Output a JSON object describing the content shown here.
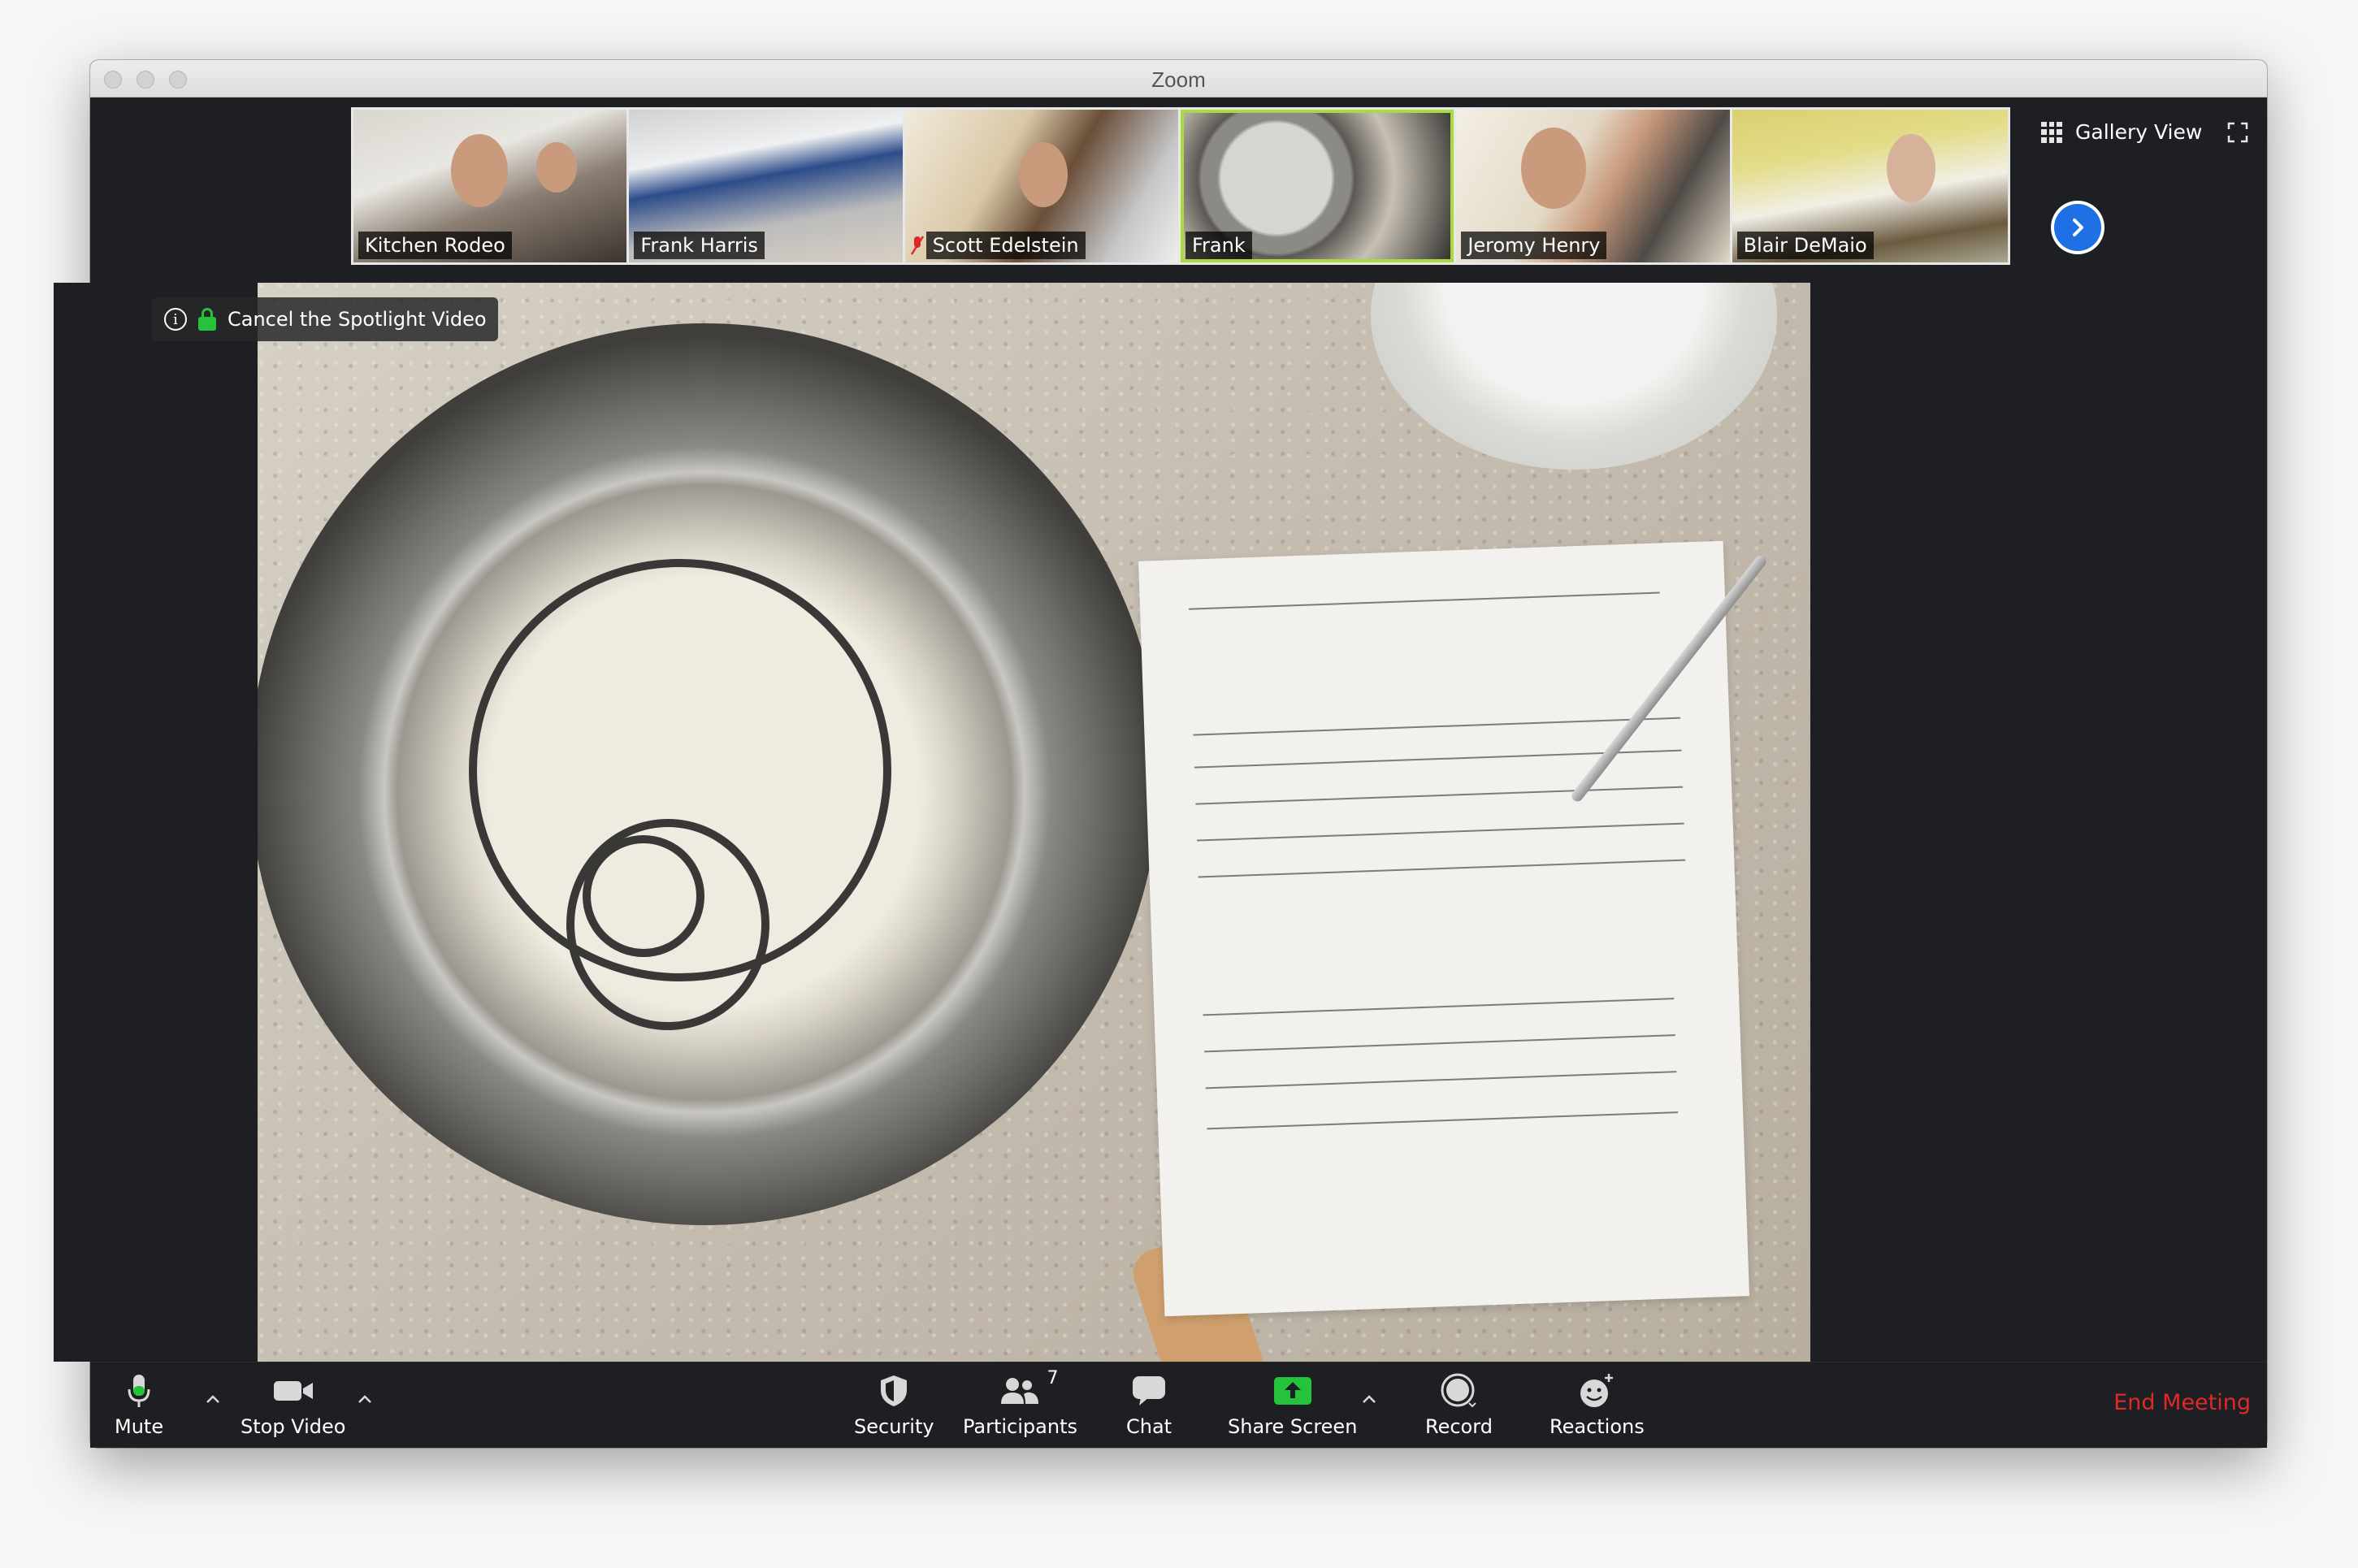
{
  "window": {
    "title": "Zoom"
  },
  "participants": [
    {
      "name": "Kitchen Rodeo",
      "muted": false
    },
    {
      "name": "Frank Harris",
      "muted": false
    },
    {
      "name": "Scott Edelstein",
      "muted": true
    },
    {
      "name": "Frank",
      "muted": false,
      "active_speaker": true
    },
    {
      "name": "Jeromy Henry",
      "muted": false
    },
    {
      "name": "Blair DeMaio",
      "muted": false
    }
  ],
  "view": {
    "gallery_label": "Gallery View"
  },
  "spotlight": {
    "cancel_label": "Cancel the Spotlight Video"
  },
  "toolbar": {
    "mute": "Mute",
    "stop_video": "Stop Video",
    "security": "Security",
    "participants": "Participants",
    "participant_count": "7",
    "chat": "Chat",
    "share_screen": "Share Screen",
    "record": "Record",
    "reactions": "Reactions",
    "end_meeting": "End Meeting"
  },
  "colors": {
    "accent_blue": "#1f6fe5",
    "share_green": "#25c23c",
    "end_red": "#e02828",
    "active_border": "#a8dc3e"
  }
}
